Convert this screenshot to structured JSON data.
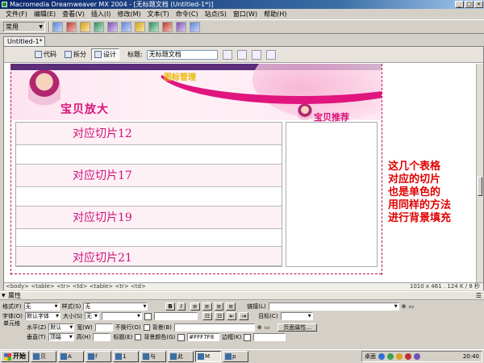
{
  "window": {
    "title": "Macromedia Dreamweaver MX 2004 - [无标题文档 (Untitled-1*)]",
    "controls": [
      "_",
      "□",
      "×"
    ]
  },
  "menubar": {
    "items": [
      "文件(F)",
      "编辑(E)",
      "查看(V)",
      "插入(I)",
      "修改(M)",
      "文本(T)",
      "命令(C)",
      "站点(S)",
      "窗口(W)",
      "帮助(H)"
    ]
  },
  "insertbar": {
    "category": "常用"
  },
  "document": {
    "tab": "Untitled-1*",
    "views": {
      "code": "代码",
      "split": "拆分",
      "design": "设计"
    },
    "title_label": "标题:",
    "title_value": "无标题文档"
  },
  "banner": {
    "logo": "图标管理",
    "left_text": "宝贝放大",
    "right_text": "宝贝推荐"
  },
  "rows": [
    {
      "label": "对应切片12"
    },
    {
      "label": ""
    },
    {
      "label": "对应切片17"
    },
    {
      "label": ""
    },
    {
      "label": "对应切片19"
    },
    {
      "label": ""
    },
    {
      "label": "对应切片21"
    }
  ],
  "annotation": {
    "lines": [
      "这几个表格",
      "对应的切片",
      "也是单色的",
      "用同样的方法",
      "进行背景填充"
    ]
  },
  "statusbar": {
    "tags": "<body> <table> <tr> <td> <table> <tr> <td>",
    "size": "1010 x 461 . 124 K / 8 秒"
  },
  "properties": {
    "header": "属性",
    "format_label": "格式(F)",
    "format_value": "无",
    "style_label": "样式(S)",
    "style_value": "无",
    "bold": "B",
    "italic": "I",
    "link_label": "链接(L)",
    "font_label": "字体(O)",
    "font_value": "默认字体",
    "size_label": "大小(S)",
    "size_value": "无",
    "target_label": "目标(C)",
    "cell_label": "单元格",
    "horz_label": "水平(Z)",
    "horz_value": "默认",
    "width_label": "宽(W)",
    "nowrap_label": "不换行(O)",
    "bg_label": "背景(B)",
    "page_props": "页面属性...",
    "vert_label": "垂直(T)",
    "vert_value": "顶端",
    "height_label": "高(H)",
    "header_label": "标题(E)",
    "bgcolor_label": "背景颜色(G)",
    "bgcolor_value": "#FFF7F8",
    "border_label": "边框(K)"
  },
  "taskbar": {
    "start": "开始",
    "tasks": [
      "贝",
      "A",
      "f",
      "1",
      "与",
      "此",
      "M",
      "p"
    ],
    "desktop": "桌面",
    "clock": "20:40"
  },
  "colors": {
    "accent_pink": "#d1137a",
    "annotation_red": "#e00000",
    "titlebar_blue": "#0a246a"
  }
}
